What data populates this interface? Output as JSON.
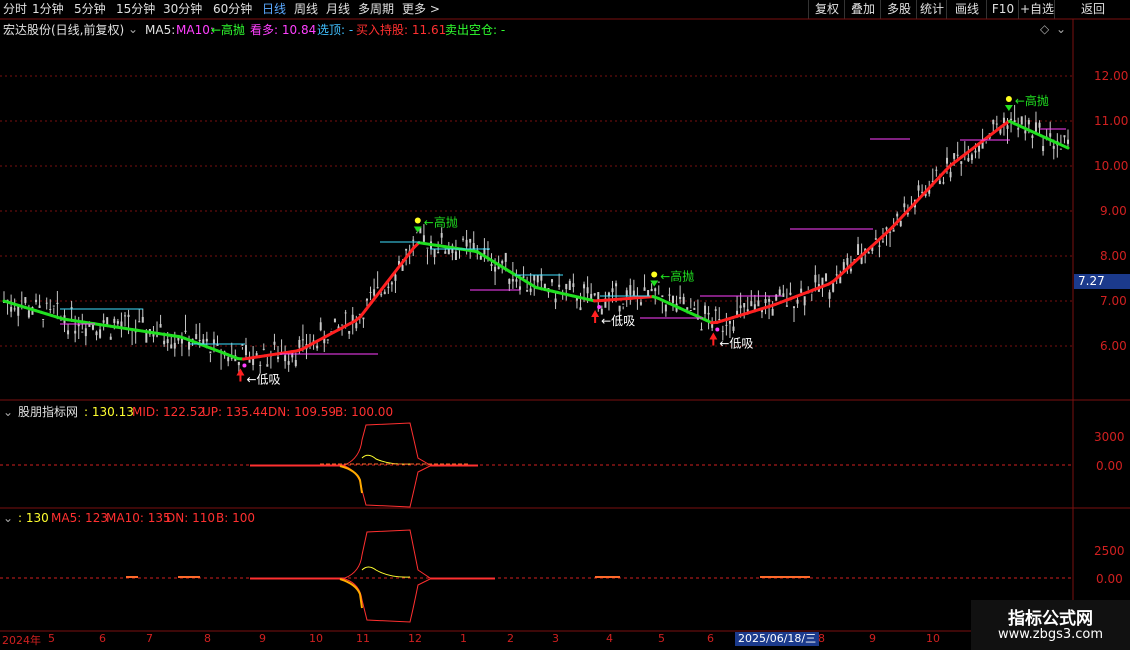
{
  "toolbar": {
    "periods": [
      "分时",
      "1分钟",
      "5分钟",
      "15分钟",
      "30分钟",
      "60分钟",
      "日线",
      "周线",
      "月线",
      "多周期",
      "更多 >"
    ],
    "active_period": "日线",
    "right_buttons": [
      "复权",
      "叠加",
      "多股",
      "统计",
      "画线",
      "F10",
      "+自选",
      "返回"
    ]
  },
  "header": {
    "stock_title": "宏达股份(日线,前复权)",
    "ma5_label": "MA5: ",
    "ma10_label": "MA10: ",
    "gaopao_label": "←高抛",
    "kanduo_label": "看多: 10.84",
    "xuanding_label": "选顶: -",
    "buy_label": "买入持股: 11.61",
    "sell_label": "卖出空仓: -"
  },
  "indicator1": {
    "title": "股朋指标网",
    "value": ": 130.13",
    "mid": "MID: 122.52",
    "up": "UP: 135.44",
    "dn": "DN: 109.59",
    "b": "B: 100.00",
    "ticks": [
      "3000",
      "0.00"
    ]
  },
  "indicator2": {
    "value": ": 130",
    "ma5": "MA5: 123",
    "ma10": "MA10: 135",
    "dn": "DN: 110",
    "b": "B: 100",
    "ticks": [
      "2500",
      "0.00"
    ]
  },
  "price_axis": {
    "ticks": [
      "12.00",
      "11.00",
      "10.00",
      "9.00",
      "8.00",
      "7.00",
      "6.00"
    ],
    "current_price": "7.27"
  },
  "date_axis": {
    "labels": [
      "2024年",
      "5",
      "6",
      "7",
      "8",
      "9",
      "10",
      "11",
      "12",
      "1",
      "2",
      "3",
      "4",
      "5",
      "6",
      "2025/06/18/三",
      "8",
      "9",
      "10"
    ],
    "highlight": "2025/06/18/三"
  },
  "chart_annotations": {
    "sell_label": "高抛",
    "buy_label": "低吸",
    "sell_prefix": "←高抛",
    "buy_prefix": "←低吸"
  },
  "chart_data": {
    "type": "line",
    "title": "宏达股份(日线,前复权)",
    "ylim": [
      5.2,
      12.8
    ],
    "x": [
      "2024-04",
      "2024-05",
      "2024-06",
      "2024-07",
      "2024-08",
      "2024-09",
      "2024-10",
      "2024-11",
      "2024-12",
      "2025-01",
      "2025-02",
      "2025-03",
      "2025-04",
      "2025-05",
      "2025-06",
      "2025-07",
      "2025-08",
      "2025-09",
      "2025-10"
    ],
    "series": [
      {
        "name": "MA",
        "values": [
          7.0,
          6.6,
          6.4,
          6.2,
          5.7,
          5.9,
          6.6,
          8.3,
          8.1,
          7.3,
          7.0,
          7.1,
          6.5,
          6.9,
          7.4,
          8.6,
          10.0,
          11.0,
          10.4
        ]
      }
    ],
    "colors": {
      "up": "#ff2020",
      "down": "#20e020",
      "candle": "#c8c8c8",
      "accent": "#ffff20",
      "magenta": "#ff40ff",
      "cyan": "#40e0ff"
    }
  },
  "watermark": {
    "line1": "指标公式网",
    "line2": "www.zbgs3.com"
  }
}
